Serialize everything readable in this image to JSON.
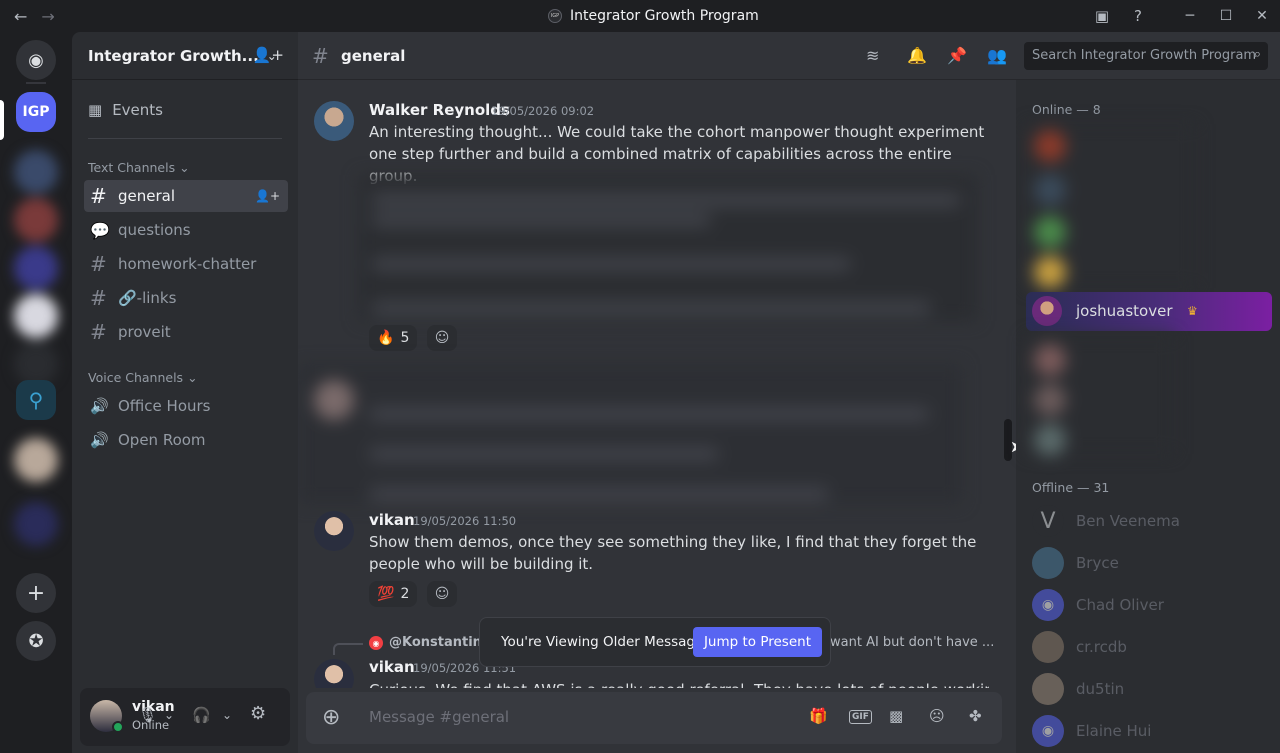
{
  "window": {
    "title": "Integrator Growth Program",
    "logo_text": "IGP"
  },
  "rail": {
    "active_server": "IGP"
  },
  "sidebar": {
    "guild_name": "Integrator Growth...",
    "events_label": "Events",
    "text_category": "Text Channels",
    "text_channels": [
      {
        "name": "general"
      },
      {
        "name": "questions"
      },
      {
        "name": "homework-chatter"
      },
      {
        "name": "🔗-links"
      },
      {
        "name": "proveit"
      }
    ],
    "voice_category": "Voice Channels",
    "voice_channels": [
      {
        "name": "Office Hours"
      },
      {
        "name": "Open Room"
      }
    ]
  },
  "user_panel": {
    "name": "vikan",
    "status": "Online"
  },
  "chat": {
    "channel": "general",
    "search_placeholder": "Search Integrator Growth Program",
    "messages": [
      {
        "author": "Walker Reynolds",
        "timestamp": "19/05/2026 09:02",
        "text": "An interesting thought... We could take the cohort manpower thought experiment one step further and build a combined matrix of capabilities across the entire group.",
        "reactions": [
          {
            "emoji": "🔥",
            "count": "5"
          }
        ]
      },
      {
        "author": "vikan",
        "timestamp": "19/05/2026 11:50",
        "text": "Show them demos, once they see something they like, I find that they forget the people who will be building it.",
        "reactions": [
          {
            "emoji": "💯",
            "count": "2"
          }
        ]
      },
      {
        "author": "vikan",
        "timestamp": "19/05/2026 11:51",
        "text": "Curious. We find that AWS is a really good referral. They have lots of people working with",
        "reply_to": "@Konstantin P",
        "reply_snippet": "want AI but don't have ..."
      }
    ],
    "older_notice": "You're Viewing Older Messages",
    "jump_label": "Jump to Present",
    "composer_placeholder": "Message #general"
  },
  "members": {
    "online_header": "Online — 8",
    "highlighted_member": "joshuastover",
    "offline_header": "Offline — 31",
    "offline": [
      {
        "name": "Ben Veenema",
        "color": "#3a3c44"
      },
      {
        "name": "Bryce",
        "color": "#4a7a9a"
      },
      {
        "name": "Chad Oliver",
        "color": "#5865f2"
      },
      {
        "name": "cr.rcdb",
        "color": "#8a7a6a"
      },
      {
        "name": "du5tin",
        "color": "#9a8a7a"
      },
      {
        "name": "Elaine Hui",
        "color": "#5865f2"
      }
    ]
  }
}
